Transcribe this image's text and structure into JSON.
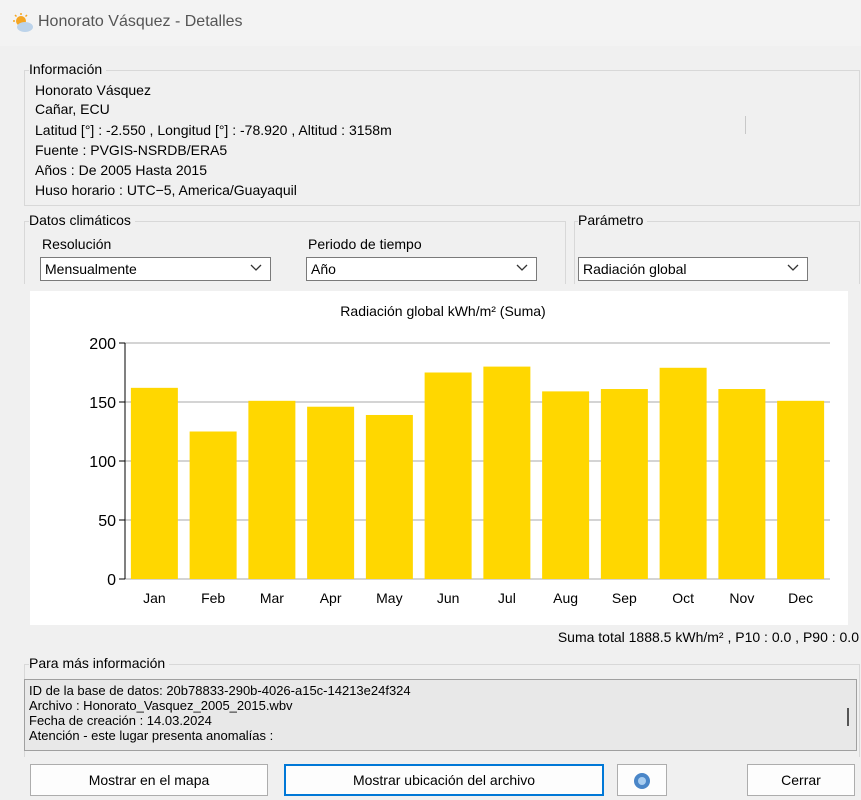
{
  "window": {
    "title": "Honorato Vásquez - Detalles"
  },
  "info": {
    "label": "Información",
    "lines": [
      "Honorato Vásquez",
      "Cañar, ECU",
      "Latitud [°] : -2.550 , Longitud [°] : -78.920 , Altitud : 3158m",
      "Fuente : PVGIS-NSRDB/ERA5",
      "Años : De 2005 Hasta 2015",
      "Huso horario : UTC−5, America/Guayaquil"
    ]
  },
  "climate": {
    "label": "Datos climáticos",
    "resolution_label": "Resolución",
    "resolution_value": "Mensualmente",
    "period_label": "Periodo de tiempo",
    "period_value": "Año"
  },
  "parameter": {
    "label": "Parámetro",
    "value": "Radiación global"
  },
  "chart_data": {
    "type": "bar",
    "title": "Radiación global kWh/m² (Suma)",
    "categories": [
      "Jan",
      "Feb",
      "Mar",
      "Apr",
      "May",
      "Jun",
      "Jul",
      "Aug",
      "Sep",
      "Oct",
      "Nov",
      "Dec"
    ],
    "values": [
      162,
      125,
      151,
      146,
      139,
      175,
      180,
      159,
      161,
      179,
      161,
      151
    ],
    "yticks": [
      "0",
      "50",
      "100",
      "150",
      "200"
    ],
    "ylim": [
      0,
      200
    ],
    "grid": true,
    "bar_color": "#ffd700"
  },
  "summary": "Suma total 1888.5 kWh/m² , P10 : 0.0 , P90 : 0.0",
  "more_info": {
    "label": "Para más información",
    "lines": [
      "ID de la base de datos: 20b78833-290b-4026-a15c-14213e24f324",
      "Archivo : Honorato_Vasquez_2005_2015.wbv",
      "Fecha de creación : 14.03.2024",
      "Atención - este lugar presenta anomalías :"
    ]
  },
  "buttons": {
    "map": "Mostrar en el mapa",
    "file_location": "Mostrar ubicación del archivo",
    "close": "Cerrar"
  }
}
